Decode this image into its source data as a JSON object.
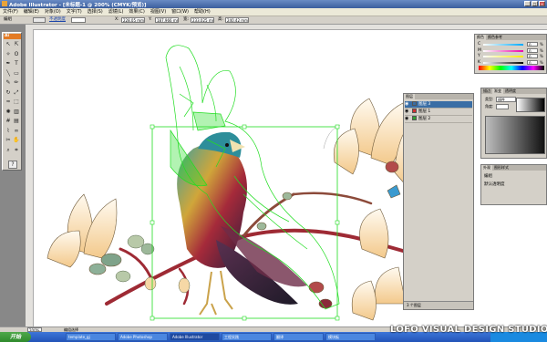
{
  "window": {
    "title": "Adobe Illustrator - [未标题-1 @ 200% (CMYK/预览)]",
    "minimize": "_",
    "maximize": "□",
    "close": "×"
  },
  "menu": [
    "文件(F)",
    "编辑(E)",
    "对象(O)",
    "文字(T)",
    "选择(S)",
    "滤镜(L)",
    "效果(C)",
    "视图(V)",
    "窗口(W)",
    "帮助(H)"
  ],
  "control_bar": {
    "label": "编组",
    "opacity_label": "不透明度",
    "x_label": "X:",
    "x_value": "228.05 mm",
    "y_label": "Y:",
    "y_value": "187.966 mm",
    "w_label": "宽:",
    "w_value": "233.025 mm",
    "h_label": "高:",
    "h_value": "240.42 mm"
  },
  "toolbox": {
    "logo": "Ai",
    "tools": [
      {
        "name": "selection-tool-icon",
        "glyph": "↖"
      },
      {
        "name": "direct-selection-tool-icon",
        "glyph": "⇱"
      },
      {
        "name": "magic-wand-tool-icon",
        "glyph": "✧"
      },
      {
        "name": "lasso-tool-icon",
        "glyph": "ʘ"
      },
      {
        "name": "pen-tool-icon",
        "glyph": "✒"
      },
      {
        "name": "type-tool-icon",
        "glyph": "T"
      },
      {
        "name": "line-tool-icon",
        "glyph": "╲"
      },
      {
        "name": "rectangle-tool-icon",
        "glyph": "▭"
      },
      {
        "name": "paintbrush-tool-icon",
        "glyph": "✎"
      },
      {
        "name": "pencil-tool-icon",
        "glyph": "✏"
      },
      {
        "name": "rotate-tool-icon",
        "glyph": "↻"
      },
      {
        "name": "scale-tool-icon",
        "glyph": "⤢"
      },
      {
        "name": "warp-tool-icon",
        "glyph": "≈"
      },
      {
        "name": "free-transform-tool-icon",
        "glyph": "⬚"
      },
      {
        "name": "symbol-sprayer-tool-icon",
        "glyph": "✺"
      },
      {
        "name": "graph-tool-icon",
        "glyph": "▥"
      },
      {
        "name": "mesh-tool-icon",
        "glyph": "#"
      },
      {
        "name": "gradient-tool-icon",
        "glyph": "▤"
      },
      {
        "name": "eyedropper-tool-icon",
        "glyph": "⌇"
      },
      {
        "name": "blend-tool-icon",
        "glyph": "∞"
      },
      {
        "name": "scissors-tool-icon",
        "glyph": "✂"
      },
      {
        "name": "hand-tool-icon",
        "glyph": "✋"
      },
      {
        "name": "zoom-tool-icon",
        "glyph": "⌕"
      },
      {
        "name": "slice-tool-icon",
        "glyph": "⌗"
      }
    ],
    "help": "?"
  },
  "panels": {
    "color": {
      "tabs": [
        "颜色",
        "颜色参考"
      ],
      "channels": [
        "C",
        "M",
        "Y",
        "K"
      ],
      "values": [
        "0",
        "0",
        "0",
        "0"
      ],
      "unit": "%"
    },
    "swatches": {
      "tabs": [
        "描边",
        "渐变",
        "透明度"
      ]
    },
    "gradient": {
      "type_label": "类型:",
      "type_value": "线性",
      "angle_label": "角度:"
    },
    "layers": {
      "tabs": [
        "图层"
      ],
      "rows": [
        {
          "label": "图层 3",
          "selected": true
        },
        {
          "label": "图层 1",
          "selected": false
        },
        {
          "label": "图层 2",
          "selected": false
        }
      ],
      "footer": "3 个图层"
    },
    "appearance": {
      "tabs": [
        "外观",
        "图形样式"
      ],
      "title": "编组",
      "item": "默认透明度"
    }
  },
  "status": {
    "zoom": "200%",
    "tool": "编组选择"
  },
  "taskbar": {
    "start": "开始",
    "tasks": [
      {
        "label": "template_gj",
        "active": false
      },
      {
        "label": "Adobe Photoshop",
        "active": false
      },
      {
        "label": "Adobe Illustrator",
        "active": true
      },
      {
        "label": "工程实践",
        "active": false
      },
      {
        "label": "翻译",
        "active": false
      },
      {
        "label": "模块板",
        "active": false
      }
    ]
  },
  "watermark": "LOFO VISUAL DESIGN STUDIO",
  "colors": {
    "title_bar": "#3b5e9e",
    "artboard": "#ffffff",
    "pasteboard": "#e3e1dd",
    "selection": "#22dd22",
    "taskbar": "#2253b8",
    "tool_accent": "#e37b25"
  }
}
